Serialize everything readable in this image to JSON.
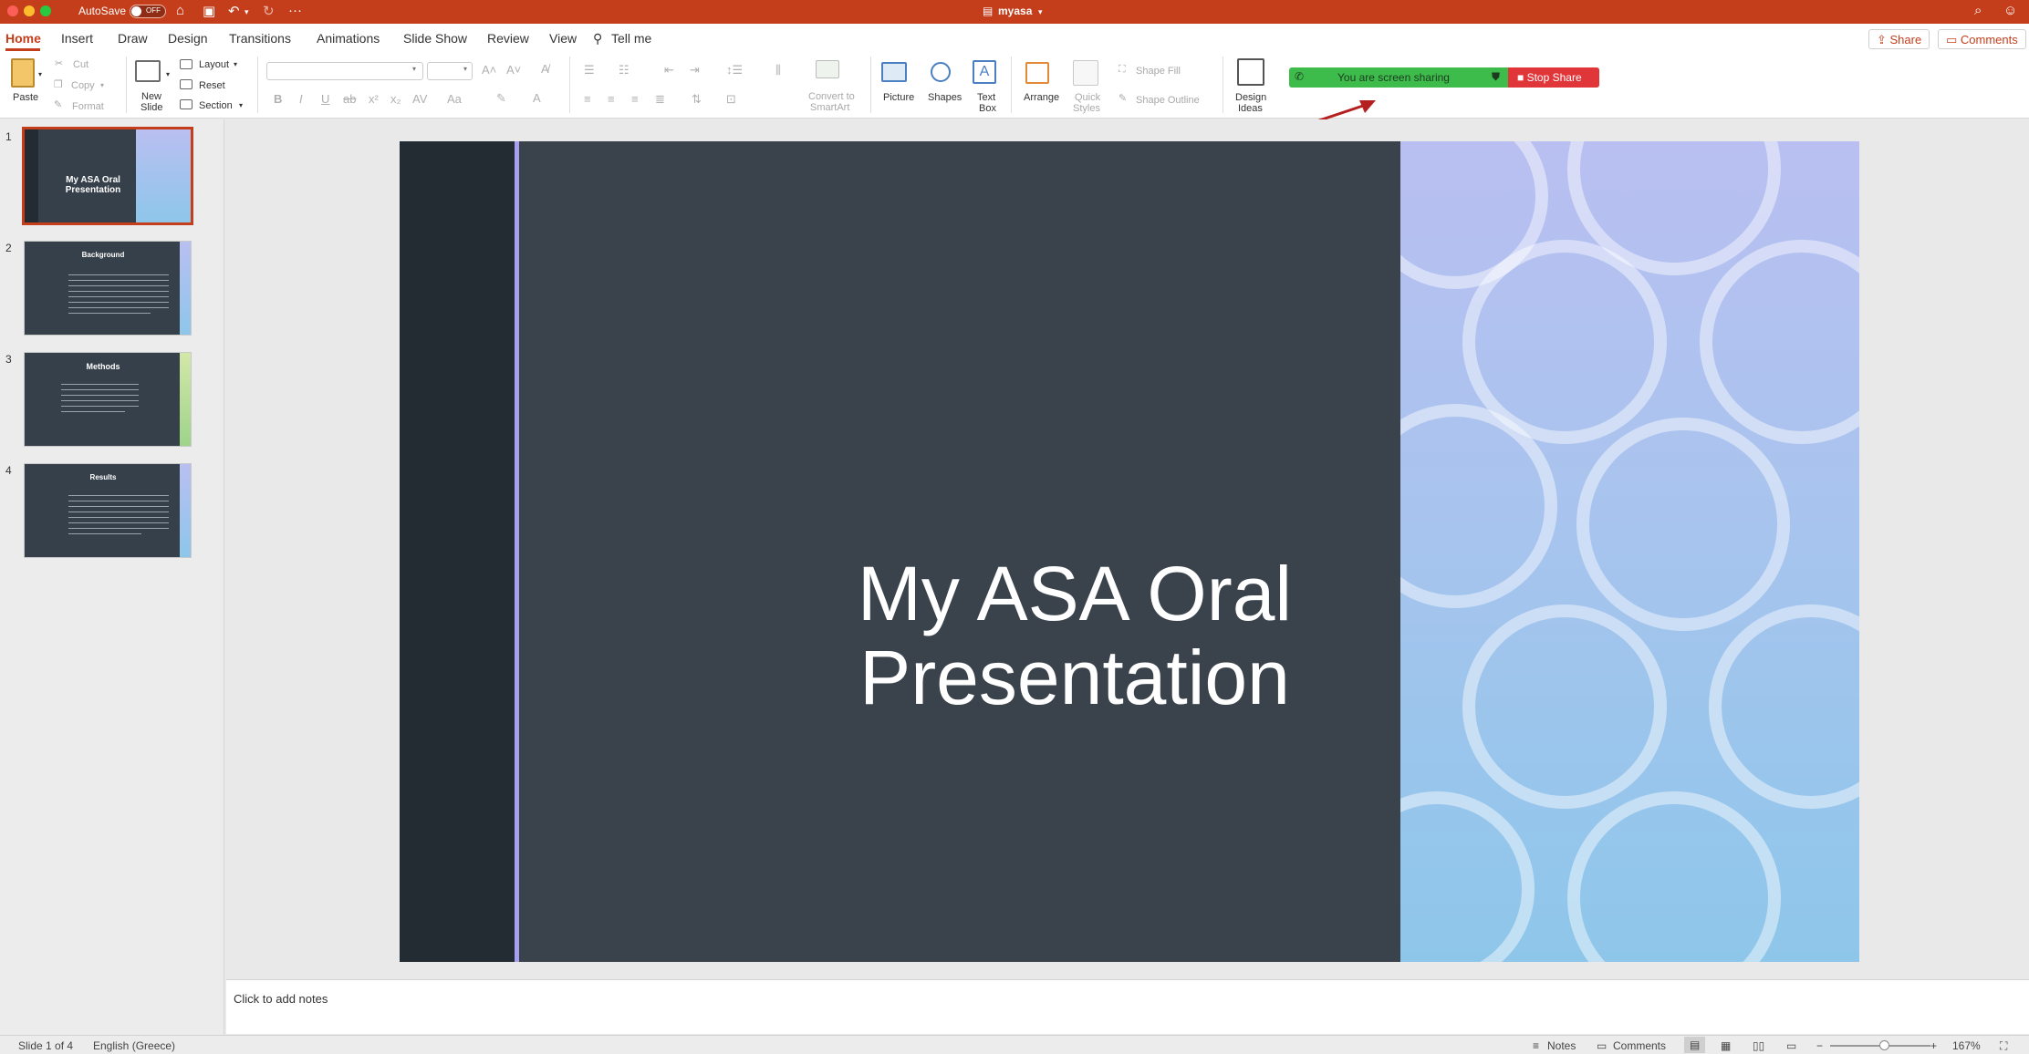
{
  "titlebar": {
    "autosave_label": "AutoSave",
    "autosave_state": "OFF",
    "doc_title": "myasa"
  },
  "tabs": [
    "Home",
    "Insert",
    "Draw",
    "Design",
    "Transitions",
    "Animations",
    "Slide Show",
    "Review",
    "View"
  ],
  "tell_me": "Tell me",
  "top_buttons": {
    "share": "Share",
    "comments": "Comments"
  },
  "ribbon": {
    "paste": "Paste",
    "cut": "Cut",
    "copy": "Copy",
    "format": "Format",
    "new_slide": [
      "New",
      "Slide"
    ],
    "layout": "Layout",
    "reset": "Reset",
    "section": "Section",
    "convert_smartart": [
      "Convert to",
      "SmartArt"
    ],
    "picture": "Picture",
    "shapes": "Shapes",
    "text_box": [
      "Text",
      "Box"
    ],
    "arrange": "Arrange",
    "quick_styles": [
      "Quick",
      "Styles"
    ],
    "shape_fill": "Shape Fill",
    "shape_outline": "Shape Outline",
    "design_ideas": [
      "Design",
      "Ideas"
    ]
  },
  "screen_share": {
    "status": "You are screen sharing",
    "stop": "Stop Share",
    "colors": {
      "bar": "#3dbc4c",
      "stop": "#e0363a"
    }
  },
  "slides": [
    {
      "number": "1",
      "title": "My ASA Oral Presentation",
      "selected": true
    },
    {
      "number": "2",
      "title": "Background"
    },
    {
      "number": "3",
      "title": "Methods"
    },
    {
      "number": "4",
      "title": "Results"
    }
  ],
  "current_slide": {
    "title_line1": "My ASA Oral",
    "title_line2": "Presentation"
  },
  "notes_placeholder": "Click to add notes",
  "status_bar": {
    "slide_info": "Slide 1 of 4",
    "language": "English (Greece)",
    "notes": "Notes",
    "comments": "Comments",
    "zoom": "167%"
  },
  "theme": {
    "accent": "#c43e1c"
  }
}
